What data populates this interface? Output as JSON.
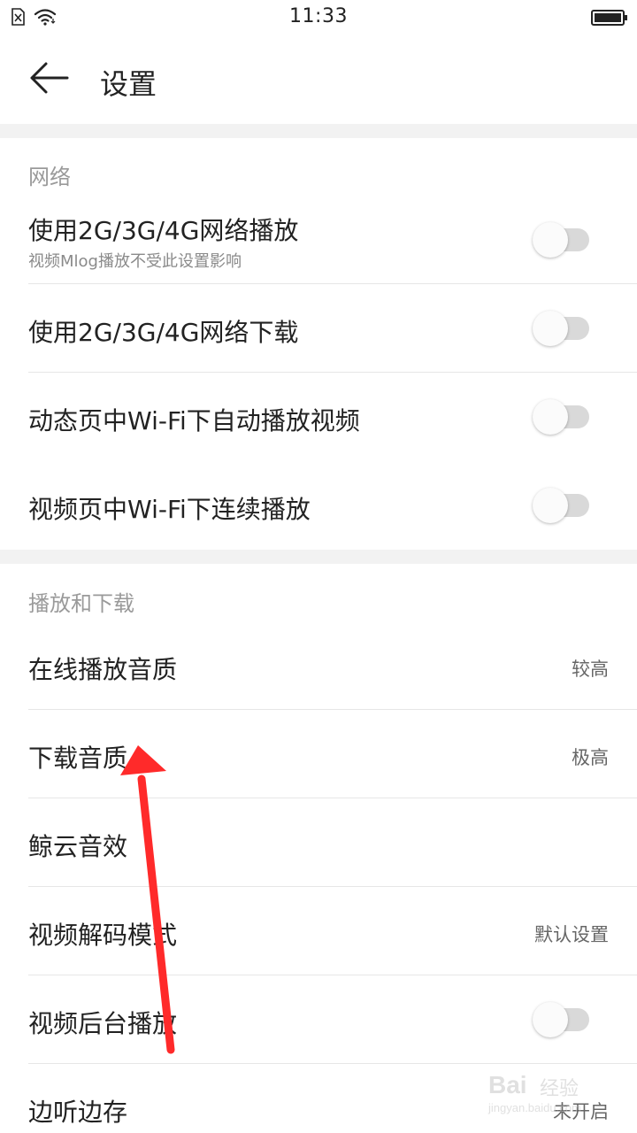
{
  "status_bar": {
    "time": "11:33"
  },
  "app_bar": {
    "title": "设置"
  },
  "sections": {
    "network": {
      "header": "网络",
      "items": [
        {
          "label": "使用2G/3G/4G网络播放",
          "subtitle": "视频Mlog播放不受此设置影响",
          "toggle_on": false
        },
        {
          "label": "使用2G/3G/4G网络下载",
          "toggle_on": false
        },
        {
          "label": "动态页中Wi-Fi下自动播放视频",
          "toggle_on": false
        },
        {
          "label": "视频页中Wi-Fi下连续播放",
          "toggle_on": false
        }
      ]
    },
    "playback": {
      "header": "播放和下载",
      "items": [
        {
          "label": "在线播放音质",
          "value": "较高"
        },
        {
          "label": "下载音质",
          "value": "极高"
        },
        {
          "label": "鲸云音效",
          "value": ""
        },
        {
          "label": "视频解码模式",
          "value": "默认设置"
        },
        {
          "label": "视频后台播放",
          "toggle_on": false
        },
        {
          "label": "边听边存",
          "value": "未开启"
        }
      ]
    }
  },
  "annotation": {
    "color": "#ff2a2a"
  },
  "watermark": {
    "brand": "Bai",
    "product": "经验",
    "url": "jingyan.baidu.com"
  },
  "colors": {
    "toggle_track": "#d9d9d9",
    "section_header": "#9a9a9a",
    "band": "#f2f2f2"
  }
}
